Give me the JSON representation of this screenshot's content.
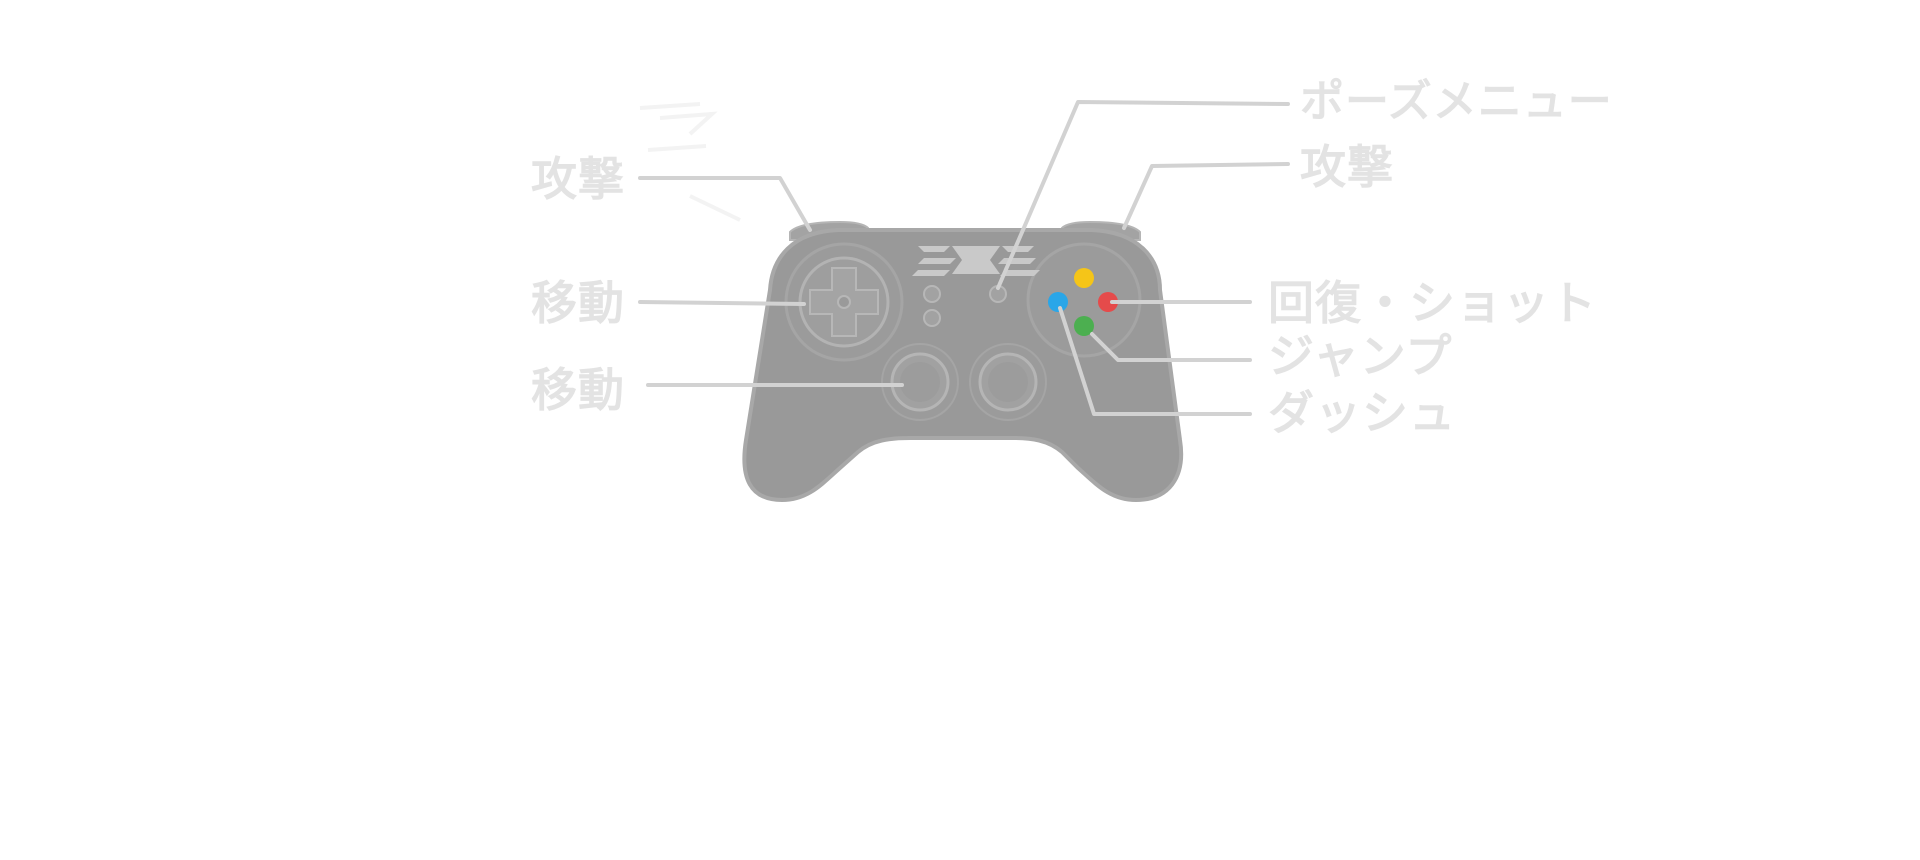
{
  "labels": {
    "attack_left": "攻撃",
    "move_dpad": "移動",
    "move_stick": "移動",
    "pause_menu": "ポーズメニュー",
    "attack_right": "攻撃",
    "recover_shot": "回復・ショット",
    "jump": "ジャンプ",
    "dash": "ダッシュ"
  },
  "colors": {
    "background": "#ffffff",
    "controller_body": "#999999",
    "controller_outline": "#a8a8a8",
    "leader_line": "#d2d2d2",
    "label_text": "#e3e3e3",
    "button_yellow": "#f5c518",
    "button_red": "#e54b4b",
    "button_blue": "#2aa6e8",
    "button_green": "#4caf50"
  },
  "icons": {
    "logo": "game-logo-emblem",
    "dpad": "dpad-icon",
    "left_stick": "left-analog-stick-icon",
    "right_stick": "right-analog-stick-icon",
    "face_buttons": "face-buttons-icon"
  }
}
